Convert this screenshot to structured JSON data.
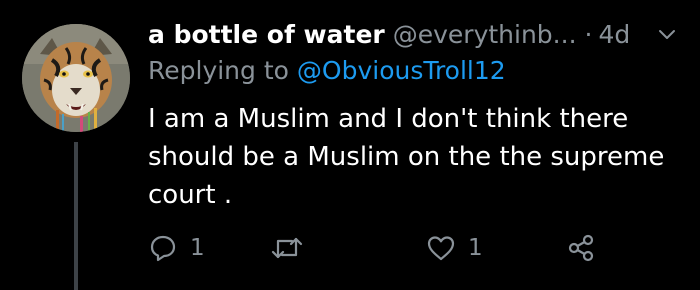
{
  "tweet": {
    "display_name": "a bottle of water",
    "handle": "@everythinb...",
    "separator": "·",
    "time": "4d",
    "replying_prefix": "Replying to",
    "replying_mention": "@ObviousTroll12",
    "text": "I am a Muslim and I don't think there should be a Muslim on the the supreme court ."
  },
  "actions": {
    "reply_count": "1",
    "like_count": "1"
  },
  "icons": {
    "avatar": "tiger-avatar",
    "caret": "chevron-down-icon",
    "reply": "reply-icon",
    "retweet": "retweet-icon",
    "like": "heart-icon",
    "share": "share-icon"
  },
  "colors": {
    "background": "#000000",
    "primary_text": "#ffffff",
    "secondary_text": "#8a9299",
    "link": "#1d9bf0"
  }
}
